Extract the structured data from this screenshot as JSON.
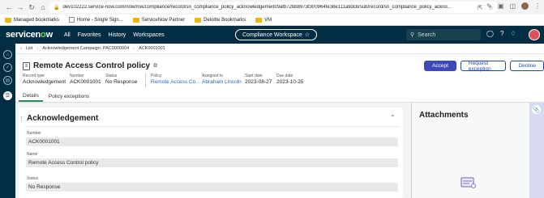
{
  "browser": {
    "url": "dev102222.service-now.com/now/risk/compliance/record/sn_compliance_policy_acknowledgement/9afb72bb8973f300964fe38e111a9dcb/sub/record/sn_compliance_policy_ackno...",
    "bookmarks": [
      "Managed bookmarks",
      "Home - Single Sign...",
      "ServiceNow Partner",
      "Deloitte Bookmarks",
      "VM"
    ]
  },
  "header": {
    "logo_text": "servicenow",
    "nav": [
      "All",
      "Favorites",
      "History",
      "Workspaces"
    ],
    "workspace": "Compliance Workspace",
    "search_placeholder": "Search"
  },
  "breadcrumb": {
    "list": "List",
    "campaign": "Acknowledgement Campaign: PAC0000004",
    "current": "ACK0001001"
  },
  "record": {
    "title": "Remote Access Control policy",
    "fields": [
      {
        "label": "Record type",
        "value": "Acknowledgement"
      },
      {
        "label": "Number",
        "value": "ACK0001001"
      },
      {
        "label": "Status",
        "value": "No Response"
      },
      {
        "label": "Policy",
        "value": "Remote Access Co..."
      },
      {
        "label": "Assigned to",
        "value": "Abraham Lincoln"
      },
      {
        "label": "Start date",
        "value": "2023-08-27"
      },
      {
        "label": "Due date",
        "value": "2023-10-25"
      }
    ]
  },
  "actions": {
    "accept": "Accept",
    "request_exception": "Request exception",
    "decline": "Decline"
  },
  "tabs": [
    "Details",
    "Policy exceptions"
  ],
  "section": {
    "title": "Acknowledgement",
    "fields": [
      {
        "label": "Number",
        "value": "ACK0001001"
      },
      {
        "label": "Name",
        "value": "Remote Access Control policy"
      },
      {
        "label": "Status",
        "value": "No Response"
      }
    ]
  },
  "sidebar": {
    "title": "Attachments"
  },
  "colors": {
    "header": "#032d42",
    "accent": "#3f4ab8",
    "logo_green": "#62d84e"
  }
}
